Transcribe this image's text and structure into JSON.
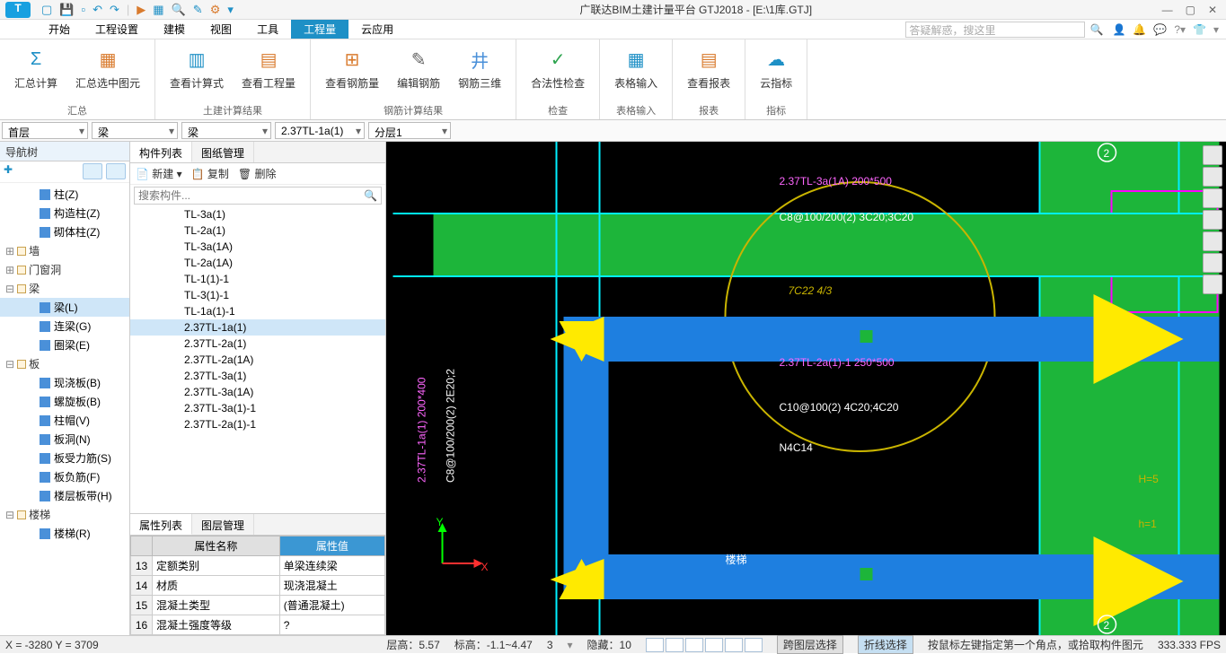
{
  "title": "广联达BIM土建计量平台 GTJ2018 - [E:\\1库.GTJ]",
  "qat_icons": [
    "open",
    "save",
    "new",
    "undo",
    "redo",
    "divider",
    "run",
    "grid",
    "search",
    "edit",
    "tools",
    "more"
  ],
  "menu": {
    "items": [
      "开始",
      "工程设置",
      "建模",
      "视图",
      "工具",
      "工程量",
      "云应用"
    ],
    "active_index": 5,
    "search_placeholder": "答疑解惑，搜这里"
  },
  "ribbon": [
    {
      "label": "汇总",
      "buttons": [
        {
          "icon": "Σ",
          "color": "#1e90c6",
          "text": "汇总计算"
        },
        {
          "icon": "▦",
          "color": "#d97b2e",
          "text": "汇总选中图元"
        }
      ]
    },
    {
      "label": "土建计算结果",
      "buttons": [
        {
          "icon": "▥",
          "color": "#1e90c6",
          "text": "查看计算式"
        },
        {
          "icon": "▤",
          "color": "#d97b2e",
          "text": "查看工程量"
        }
      ]
    },
    {
      "label": "钢筋计算结果",
      "buttons": [
        {
          "icon": "⊞",
          "color": "#d97b2e",
          "text": "查看钢筋量"
        },
        {
          "icon": "✎",
          "color": "#666",
          "text": "编辑钢筋"
        },
        {
          "icon": "井",
          "color": "#4a90d9",
          "text": "钢筋三维"
        }
      ]
    },
    {
      "label": "检查",
      "buttons": [
        {
          "icon": "✓",
          "color": "#2ea44f",
          "text": "合法性检查"
        }
      ]
    },
    {
      "label": "表格输入",
      "buttons": [
        {
          "icon": "▦",
          "color": "#1e90c6",
          "text": "表格输入"
        }
      ]
    },
    {
      "label": "报表",
      "buttons": [
        {
          "icon": "▤",
          "color": "#d97b2e",
          "text": "查看报表"
        }
      ]
    },
    {
      "label": "指标",
      "buttons": [
        {
          "icon": "☁",
          "color": "#1e90c6",
          "text": "云指标"
        }
      ]
    }
  ],
  "dropdowns": [
    "首层",
    "梁",
    "梁",
    "2.37TL-1a(1)",
    "分层1"
  ],
  "nav": {
    "title": "导航树",
    "categories": [
      {
        "name": "",
        "items": [
          "柱(Z)",
          "构造柱(Z)",
          "砌体柱(Z)"
        ]
      },
      {
        "name": "墙",
        "items": []
      },
      {
        "name": "门窗洞",
        "items": []
      },
      {
        "name": "梁",
        "items": [
          "梁(L)",
          "连梁(G)",
          "圈梁(E)"
        ],
        "selected": 0
      },
      {
        "name": "板",
        "items": [
          "现浇板(B)",
          "螺旋板(B)",
          "柱帽(V)",
          "板洞(N)",
          "板受力筋(S)",
          "板负筋(F)",
          "楼层板带(H)"
        ]
      },
      {
        "name": "楼梯",
        "items": [
          "楼梯(R)"
        ]
      }
    ]
  },
  "comp_panel": {
    "tabs": [
      "构件列表",
      "图纸管理"
    ],
    "active_tab": 0,
    "toolbar": [
      "📄 新建 ▾",
      "📋 复制",
      "🗑 删除"
    ],
    "search_placeholder": "搜索构件...",
    "items": [
      "TL-3a(1)",
      "TL-2a(1)",
      "TL-3a(1A)",
      "TL-2a(1A)",
      "TL-1(1)-1",
      "TL-3(1)-1",
      "TL-1a(1)-1",
      "2.37TL-1a(1)",
      "2.37TL-2a(1)",
      "2.37TL-2a(1A)",
      "2.37TL-3a(1)",
      "2.37TL-3a(1A)",
      "2.37TL-3a(1)-1",
      "2.37TL-2a(1)-1"
    ],
    "selected": 7
  },
  "prop_panel": {
    "tabs": [
      "属性列表",
      "图层管理"
    ],
    "active_tab": 0,
    "headers": [
      "",
      "属性名称",
      "属性值"
    ],
    "rows": [
      [
        "13",
        "定额类别",
        "单梁连续梁"
      ],
      [
        "14",
        "材质",
        "现浇混凝土"
      ],
      [
        "15",
        "混凝土类型",
        "(普通混凝土)"
      ],
      [
        "16",
        "混凝土强度等级",
        "?"
      ]
    ]
  },
  "canvas_labels": {
    "l1": "2.37TL-1a(1) 200*400",
    "l2": "C8@100/200(2) 2E20;2",
    "l3": "2.37TL-3a(1A) 200*500",
    "l4": "C8@100/200(2) 3C20;3C20",
    "l5": "7C22 4/3",
    "l6": "2.37TL-2a(1)-1 250*500",
    "l7": "C10@100(2) 4C20;4C20",
    "l8": "N4C14",
    "l9": "楼梯",
    "l10": "H=5",
    "l11": "h=1",
    "badge1": "2",
    "badge2": "2",
    "ax_y": "Y",
    "ax_x": "X"
  },
  "status": {
    "coords": "X = -3280 Y = 3709",
    "floor_h": "层高：5.57",
    "elev": "标高：-1.1~4.47",
    "count": "3",
    "hidden": "隐藏：10",
    "btn1": "跨图层选择",
    "btn2": "折线选择",
    "hint": "按鼠标左键指定第一个角点，或拾取构件图元",
    "fps": "333.333 FPS"
  }
}
